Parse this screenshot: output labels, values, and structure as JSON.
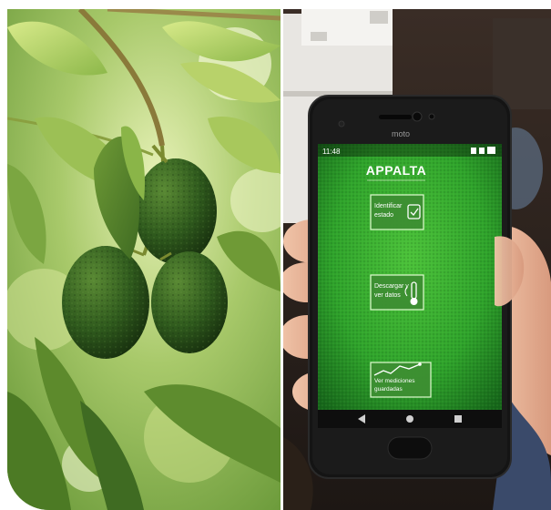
{
  "phone": {
    "brand": "moto",
    "status_time": "11:48",
    "app_title": "APPALTA",
    "menu": [
      {
        "line1": "Identificar",
        "line2": "estado",
        "icon": "check-bag-icon"
      },
      {
        "line1": "Descargar y",
        "line2": "ver datos",
        "icon": "thermometer-icon"
      },
      {
        "line1": "Ver mediciones",
        "line2": "guardadas",
        "icon": "line-chart-icon"
      }
    ],
    "nav": [
      "back-triangle-icon",
      "home-circle-icon",
      "recents-square-icon"
    ]
  },
  "colors": {
    "leaf_green": "#7fae3a",
    "avocado_green": "#2f5a1d",
    "screen_green": "#2fa32b",
    "phone_body": "#141414"
  }
}
